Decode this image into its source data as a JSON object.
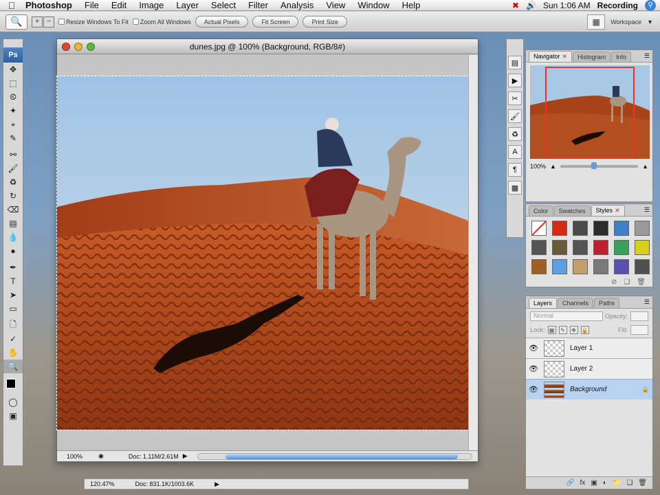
{
  "menubar": {
    "app": "Photoshop",
    "menus": [
      "File",
      "Edit",
      "Image",
      "Layer",
      "Select",
      "Filter",
      "Analysis",
      "View",
      "Window",
      "Help"
    ],
    "clock": "Sun 1:06 AM",
    "recording": "Recording"
  },
  "options": {
    "resize_windows": "Resize Windows To Fit",
    "zoom_all": "Zoom All Windows",
    "actual_pixels": "Actual Pixels",
    "fit_screen": "Fit Screen",
    "print_size": "Print Size",
    "workspace": "Workspace"
  },
  "toolbox": {
    "logo": "Ps"
  },
  "document": {
    "title": "dunes.jpg @ 100% (Background, RGB/8#)",
    "zoom": "100%",
    "doc_size": "Doc: 1.11M/2.61M"
  },
  "document2": {
    "zoom": "120.47%",
    "doc_size": "Doc: 831.1K/1003.6K"
  },
  "navigator": {
    "tabs": [
      "Navigator",
      "Histogram",
      "Info"
    ],
    "zoom": "100%"
  },
  "styles": {
    "tabs": [
      "Color",
      "Swatches",
      "Styles"
    ],
    "swatch_colors": [
      "#ffffff",
      "#d62a15",
      "#4a4a4a",
      "#2b2b2b",
      "#3d80c6",
      "#9a9a9a",
      "#555555",
      "#6b5a3a",
      "#545454",
      "#c02030",
      "#3aa05a",
      "#d8d020",
      "#a06020",
      "#5aa0e0",
      "#c0a070",
      "#7a7a7a",
      "#5a50b0",
      "#505050"
    ]
  },
  "layers": {
    "tabs": [
      "Layers",
      "Channels",
      "Paths"
    ],
    "blend_mode": "Normal",
    "opacity_label": "Opacity:",
    "lock_label": "Lock:",
    "fill_label": "Fill:",
    "items": [
      {
        "name": "Layer 1"
      },
      {
        "name": "Layer 2"
      },
      {
        "name": "Background"
      }
    ]
  }
}
